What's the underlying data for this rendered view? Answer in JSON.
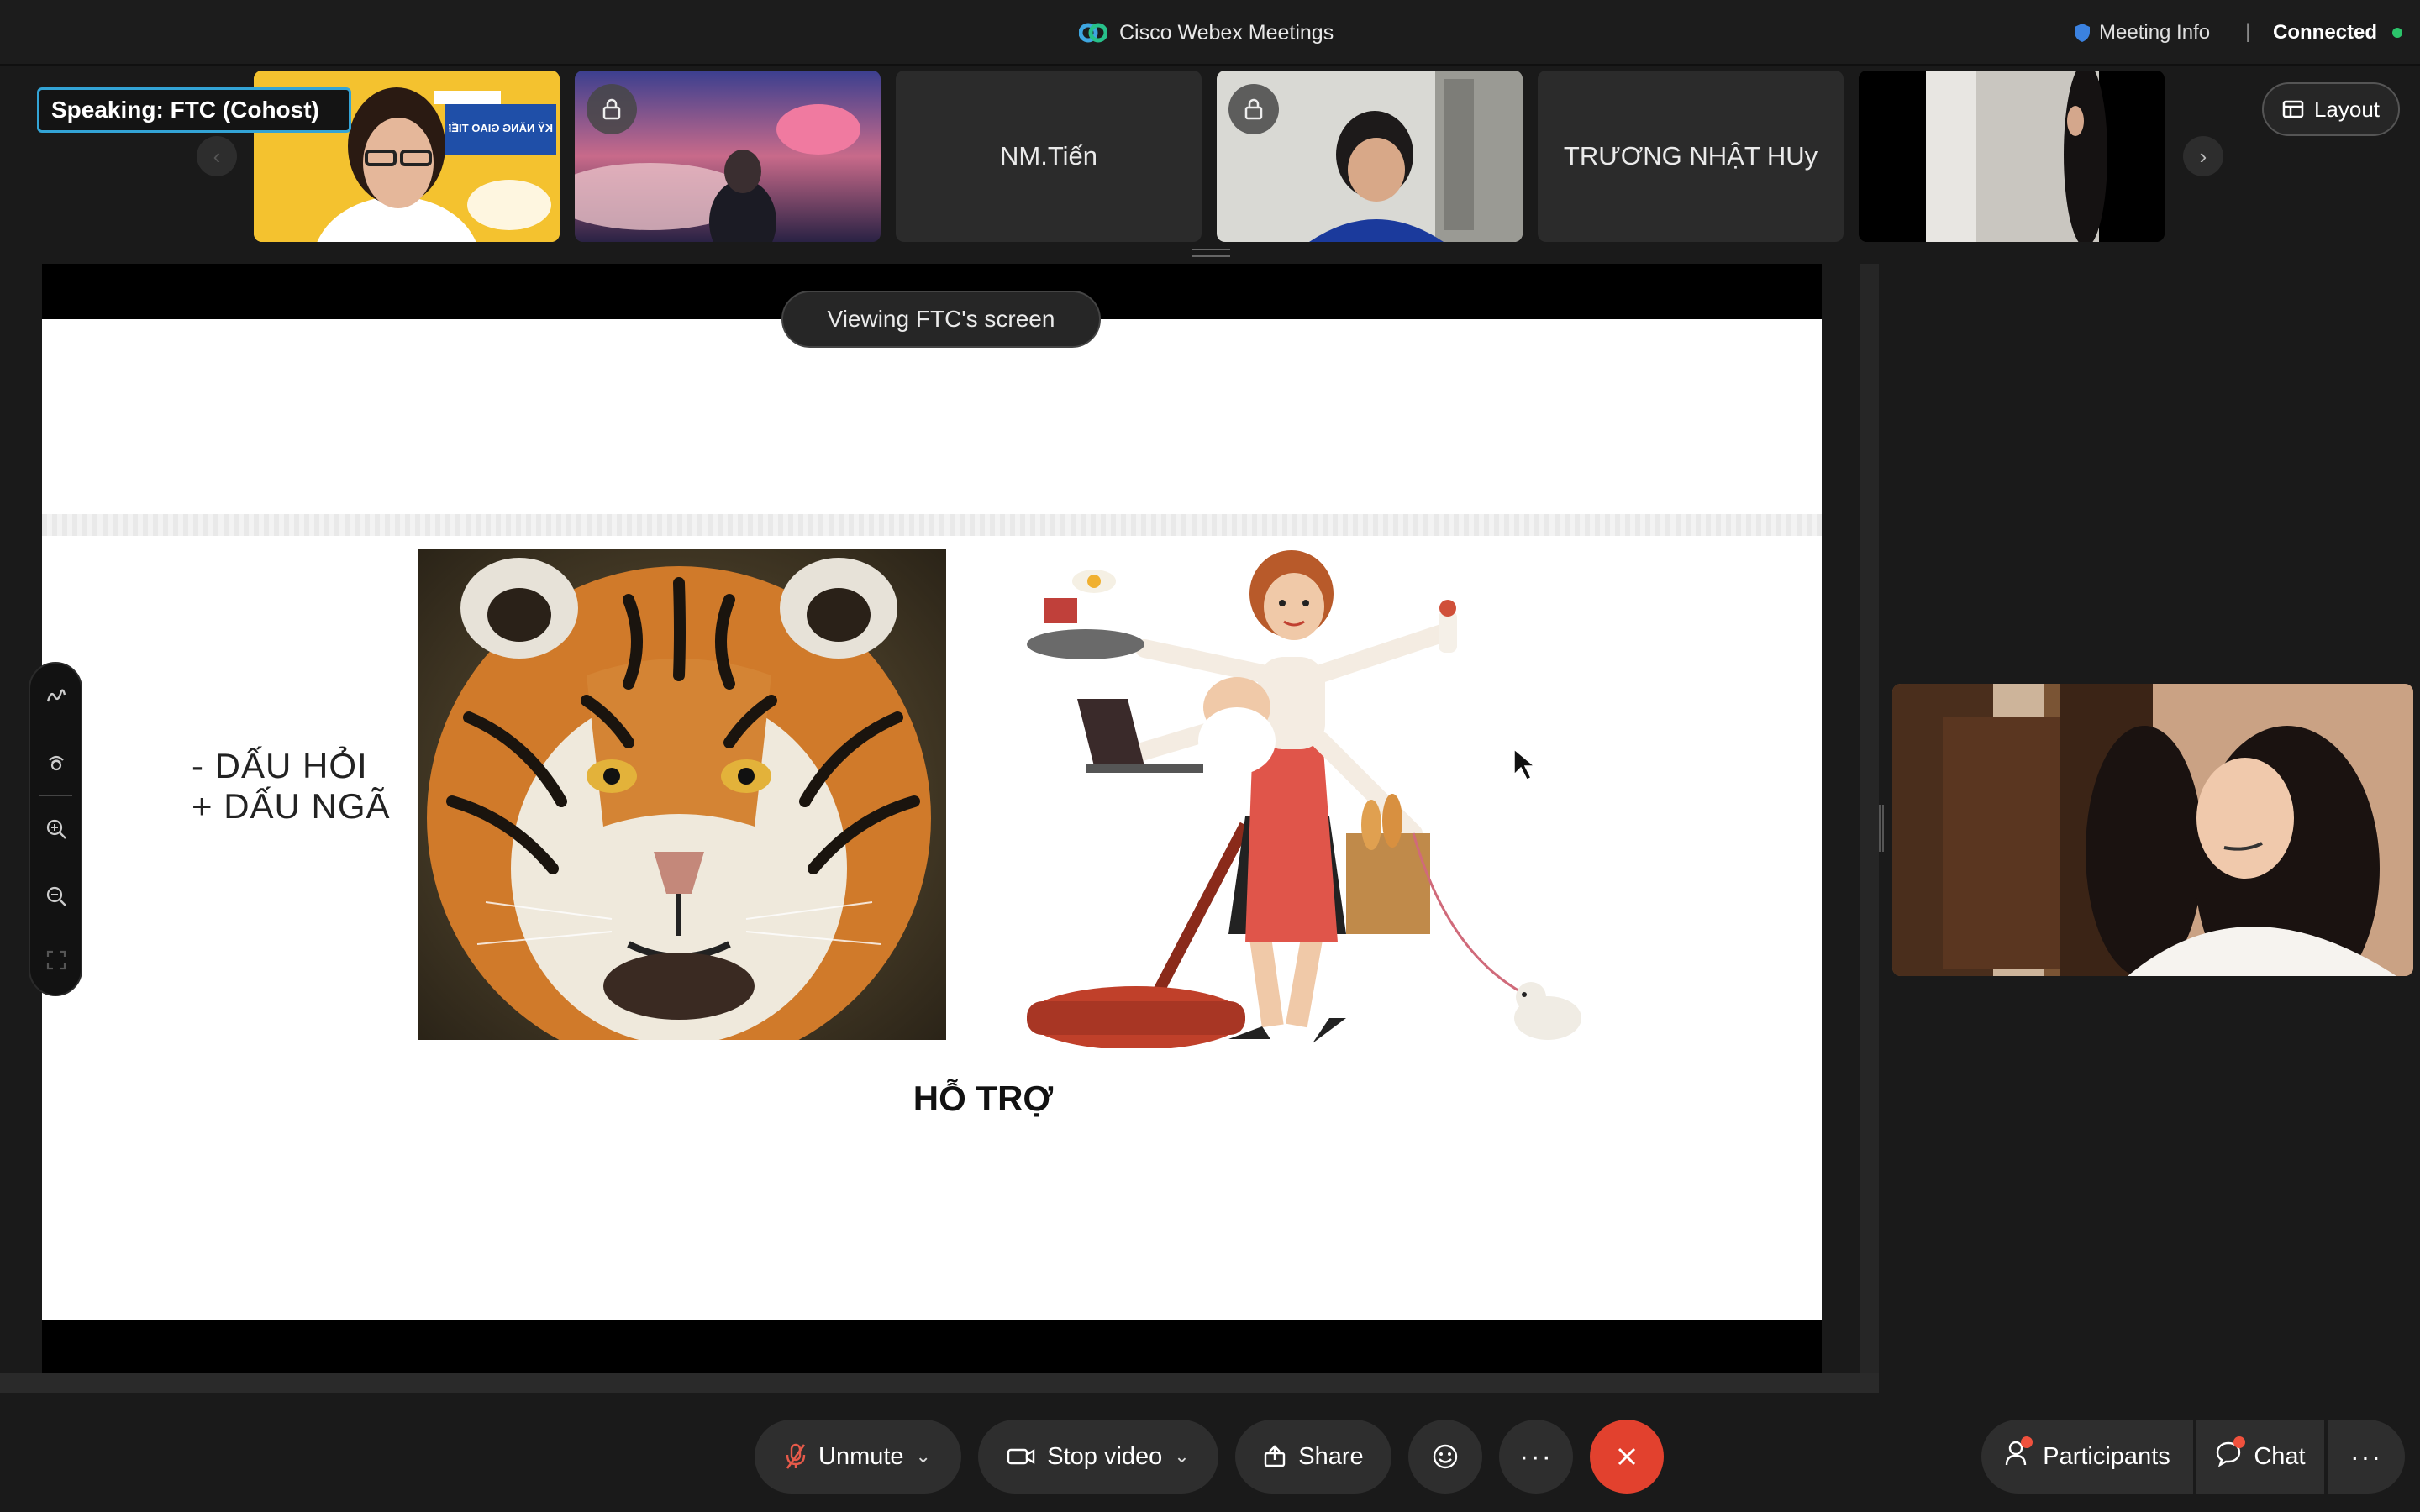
{
  "window": {
    "app_title": "Cisco Webex Meetings",
    "meeting_info_label": "Meeting Info",
    "separator": "|",
    "connection_status": "Connected"
  },
  "filmstrip": {
    "speaking_label": "Speaking:  FTC (Cohost)",
    "tiles": [
      {
        "type": "video",
        "name": ""
      },
      {
        "type": "video",
        "name": "",
        "locked": true
      },
      {
        "type": "name-only",
        "name": "NM.Tiến"
      },
      {
        "type": "video",
        "name": "",
        "locked": true
      },
      {
        "type": "name-only",
        "name": "TRƯƠNG NHẬT HUy"
      },
      {
        "type": "video",
        "name": ""
      }
    ],
    "thumb_banner_text": "KỸ NĂNG GIAO TIẾP",
    "layout_label": "Layout",
    "prev_icon": "chevron-left-icon",
    "next_icon": "chevron-right-icon"
  },
  "share": {
    "viewing_label": "Viewing FTC's screen",
    "slide": {
      "line1": "- DẤU HỎI",
      "line2": "+ DẤU NGÃ",
      "caption": "HỖ TRỢ"
    },
    "annotation_tools": [
      "pen-icon",
      "laser-pointer-icon",
      "zoom-in-icon",
      "zoom-out-icon",
      "fit-screen-icon"
    ]
  },
  "controls": {
    "unmute": "Unmute",
    "stop_video": "Stop video",
    "share": "Share",
    "participants": "Participants",
    "chat": "Chat"
  },
  "colors": {
    "accent_blue": "#33a4d6",
    "connected_green": "#2bc46a",
    "leave_red": "#e2412e",
    "notification_red": "#f0513d"
  }
}
